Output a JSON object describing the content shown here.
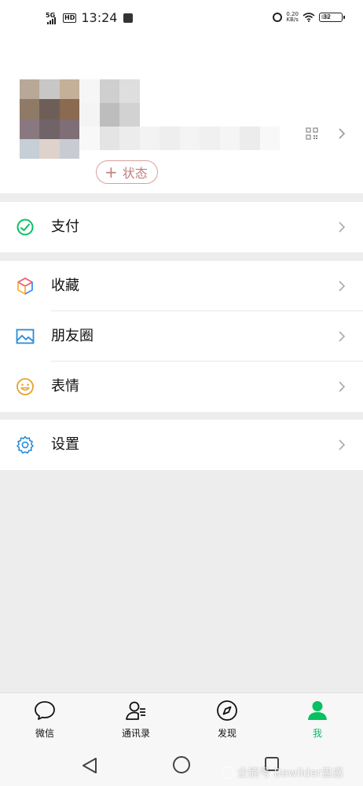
{
  "status_bar": {
    "network": "5G",
    "hd": "HD",
    "time": "13:24",
    "speed_value": "0.20",
    "speed_unit": "KB/s",
    "battery": "32"
  },
  "profile": {
    "status_button": "状态"
  },
  "menu": {
    "pay": "支付",
    "favorites": "收藏",
    "moments": "朋友圈",
    "stickers": "表情",
    "settings": "设置"
  },
  "tabs": [
    {
      "label": "微信",
      "icon": "chat-bubble-icon"
    },
    {
      "label": "通讯录",
      "icon": "contacts-icon"
    },
    {
      "label": "发现",
      "icon": "compass-icon"
    },
    {
      "label": "我",
      "icon": "person-icon"
    }
  ],
  "active_tab": "我",
  "watermark": "企鹅号 Bewilder蛊惑",
  "colors": {
    "accent_green": "#07c160",
    "background": "#ededed",
    "status_chip": "#c08080"
  }
}
